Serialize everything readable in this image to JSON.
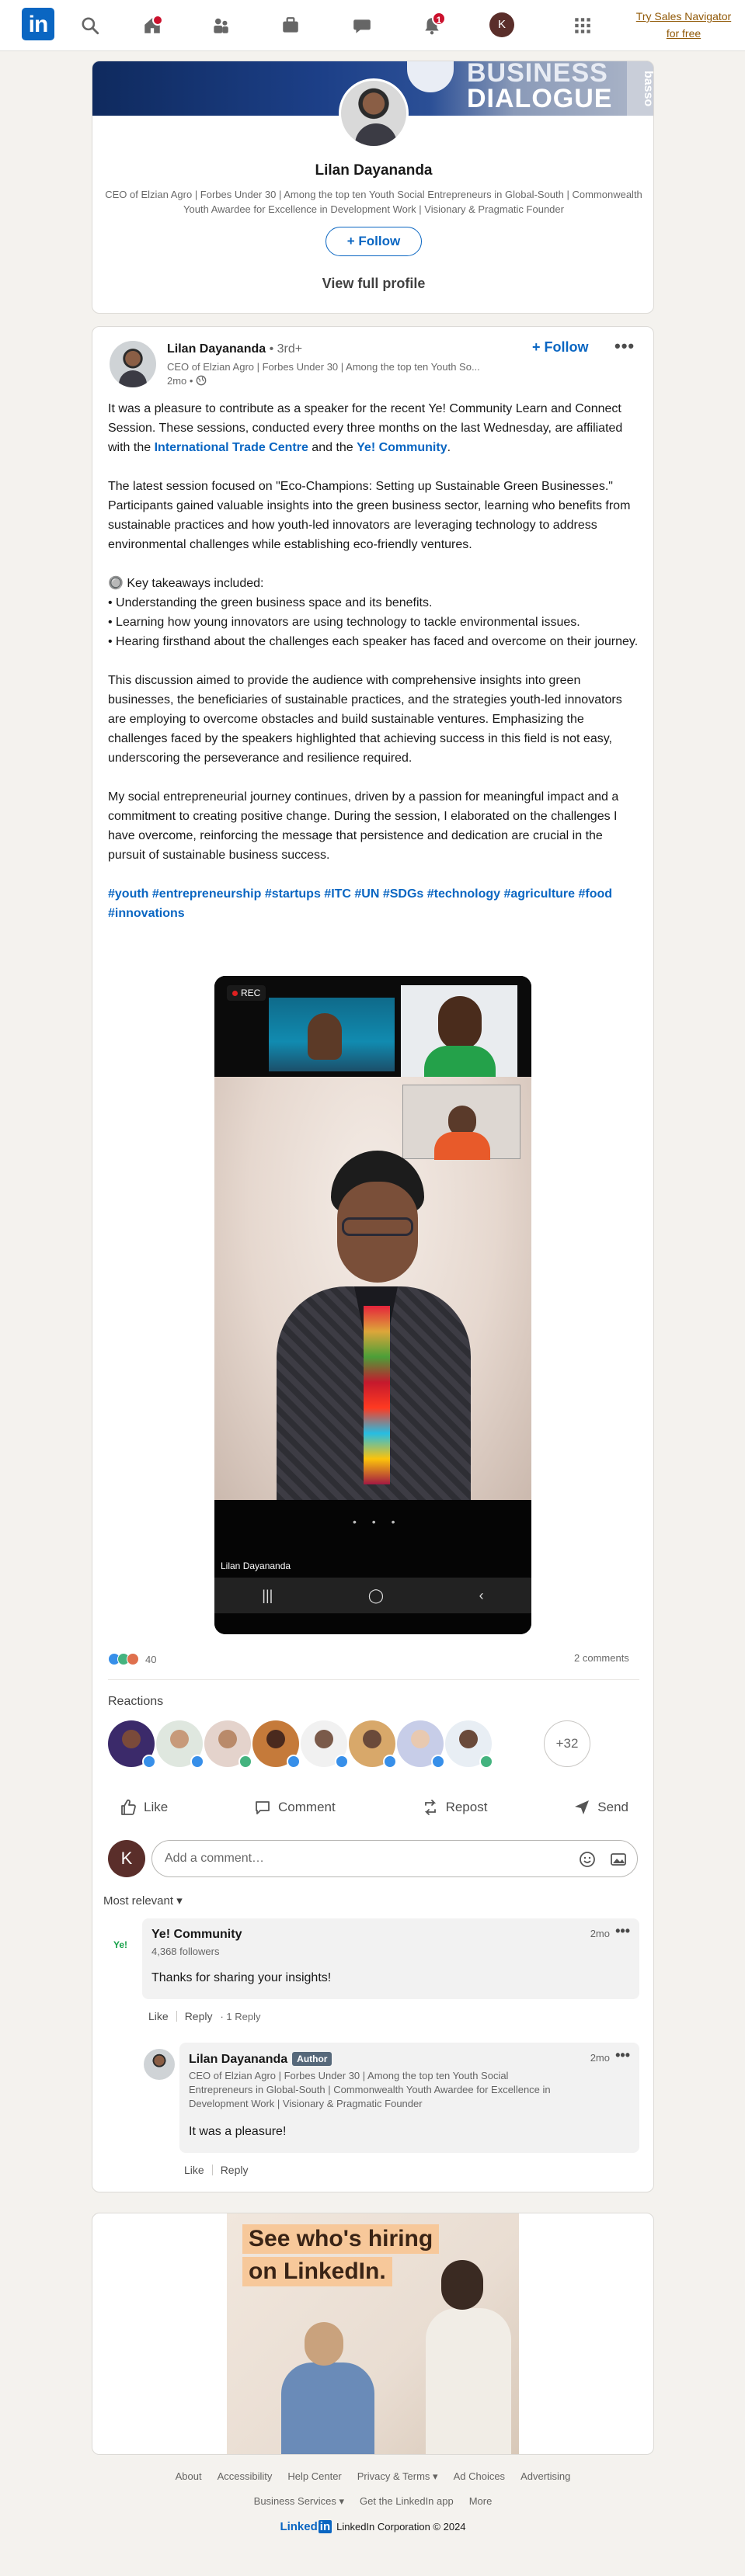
{
  "nav": {
    "logo": "in",
    "me_initial": "K",
    "notification_count": "1",
    "sales_navigator": "Try Sales Navigator for free"
  },
  "profile": {
    "banner_line1": "BUSINESS",
    "banner_line2": "DIALOGUE",
    "banner_side": "basso",
    "name": "Lilan Dayananda",
    "headline": "CEO of Elzian Agro | Forbes Under 30 | Among the top ten Youth Social Entrepreneurs in Global-South | Commonwealth Youth Awardee for Excellence in Development Work | Visionary & Pragmatic Founder",
    "follow_label": "+ Follow",
    "view_full_profile": "View full profile"
  },
  "post": {
    "author": "Lilan Dayananda",
    "degree": "• 3rd+",
    "subtitle": "CEO of Elzian Agro | Forbes Under 30 | Among the top ten Youth So...",
    "time": "2mo •",
    "follow_label": "+ Follow",
    "more": "•••",
    "para1_a": "It was a pleasure to contribute as a speaker for the recent Ye! Community Learn and Connect Session. These sessions, conducted every three months on the last Wednesday, are affiliated with the ",
    "para1_link1": "International Trade Centre",
    "para1_b": " and the ",
    "para1_link2": "Ye! Community",
    "para1_c": ".",
    "para2": "The latest session focused on \"Eco-Champions: Setting up Sustainable Green Businesses.\" Participants gained valuable insights into the green business sector, learning who benefits from sustainable practices and how youth-led innovators are leveraging technology to address environmental challenges while establishing eco-friendly ventures.",
    "takeaways_title": "🔘 Key takeaways included:",
    "takeaway1": "• Understanding the green business space and its benefits.",
    "takeaway2": "• Learning how young innovators are using technology to tackle environmental issues.",
    "takeaway3": "• Hearing firsthand about the challenges each speaker has faced and overcome on their journey.",
    "para4": "This discussion aimed to provide the audience with comprehensive insights into green businesses, the beneficiaries of sustainable practices, and the strategies youth-led innovators are employing to overcome obstacles and build sustainable ventures. Emphasizing the challenges faced by the speakers highlighted that achieving success in this field is not easy, underscoring the perseverance and resilience required.",
    "para5": "My social entrepreneurial journey continues, driven by a passion for meaningful impact and a commitment to creating positive change. During the session, I elaborated on the challenges I have overcome, reinforcing the message that persistence and dedication are crucial in the pursuit of sustainable business success.",
    "hashtags": "#youth #entrepreneurship #startups #ITC #UN #SDGs #technology #agriculture #food #innovations",
    "video": {
      "rec": "REC",
      "presenter": "Lilan Dayananda",
      "dots": "• • •",
      "nav_recent": "|||",
      "nav_home": "◯",
      "nav_back": "‹"
    },
    "reaction_count": "40",
    "comments_count": "2 comments",
    "reactions_title": "Reactions",
    "more_reactors": "+32",
    "actions": {
      "like": "Like",
      "comment": "Comment",
      "repost": "Repost",
      "send": "Send"
    },
    "comment_placeholder": "Add a comment…",
    "most_relevant": "Most relevant ▾"
  },
  "comments": [
    {
      "author": "Ye! Community",
      "avatar_text": "Ye!",
      "sub": "4,368 followers",
      "time": "2mo",
      "body": "Thanks for sharing your insights!",
      "like": "Like",
      "reply": "Reply",
      "reply_count": "· 1 Reply"
    },
    {
      "author": "Lilan Dayananda",
      "badge": "Author",
      "sub": "CEO of Elzian Agro | Forbes Under 30 | Among the top ten Youth Social Entrepreneurs in Global-South | Commonwealth Youth Awardee for Excellence in Development Work | Visionary & Pragmatic Founder",
      "time": "2mo",
      "body": "It was a pleasure!",
      "like": "Like",
      "reply": "Reply"
    }
  ],
  "ad": {
    "headline1": "See who's hiring",
    "headline2": "on LinkedIn."
  },
  "footer": {
    "row1": [
      "About",
      "Accessibility",
      "Help Center",
      "Privacy & Terms ▾",
      "Ad Choices",
      "Advertising"
    ],
    "row2": [
      "Business Services ▾",
      "Get the LinkedIn app",
      "More"
    ],
    "brand_linked": "Linked",
    "brand_in": "in",
    "copyright": "LinkedIn Corporation © 2024"
  },
  "colors": {
    "brand": "#0a66c2",
    "background": "#f4f2ee",
    "notification": "#cb112d",
    "sales": "#915907"
  }
}
